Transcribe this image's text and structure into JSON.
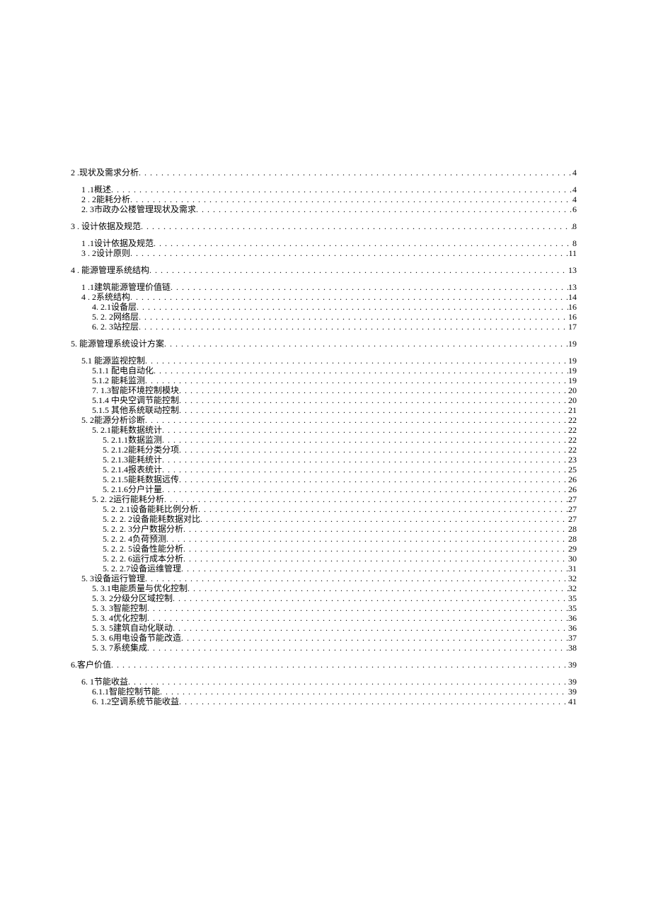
{
  "toc": [
    {
      "indent": 0,
      "label": "2     .现状及需求分析",
      "page": "4",
      "gap_after": 10
    },
    {
      "indent": 15,
      "label": "1     .1概述",
      "page": "4"
    },
    {
      "indent": 15,
      "label": "2     . 2能耗分析",
      "page": "4"
    },
    {
      "indent": 15,
      "label": "2. 3市政办公楼管理现状及需求",
      "page": "6",
      "gap_after": 10
    },
    {
      "indent": 0,
      "label": "3     . 设计依据及规范",
      "page": "8",
      "gap_after": 10
    },
    {
      "indent": 15,
      "label": "1     .1设计依据及规范",
      "page": "8"
    },
    {
      "indent": 15,
      "label": "3     . 2设计原则",
      "page": "11",
      "gap_after": 10
    },
    {
      "indent": 0,
      "label": "4     . 能源管理系统结构",
      "page": "13",
      "gap_after": 10
    },
    {
      "indent": 15,
      "label": "1     .1建筑能源管理价值链",
      "page": "13"
    },
    {
      "indent": 15,
      "label": "4     . 2系统结构",
      "page": "14"
    },
    {
      "indent": 30,
      "label": "4.    2.1设备层",
      "page": "16"
    },
    {
      "indent": 30,
      "label": "5.    2. 2网络层",
      "page": "16"
    },
    {
      "indent": 30,
      "label": "6.    2. 3站控层",
      "page": "17",
      "gap_after": 10
    },
    {
      "indent": 0,
      "label": "5. 能源管理系统设计方案",
      "page": "19",
      "gap_after": 10
    },
    {
      "indent": 15,
      "label": "5.1     能源监视控制",
      "page": "19"
    },
    {
      "indent": 30,
      "label": "5.1.1     配电自动化",
      "page": "19"
    },
    {
      "indent": 30,
      "label": "5.1.2     能耗监测",
      "page": "19"
    },
    {
      "indent": 30,
      "label": "7.    1.3智能环境控制模块",
      "page": "20"
    },
    {
      "indent": 30,
      "label": "5.1.4     中央空调节能控制",
      "page": "20"
    },
    {
      "indent": 30,
      "label": "5.1.5     其他系统联动控制",
      "page": "21"
    },
    {
      "indent": 15,
      "label": "5. 2能源分析诊断",
      "page": "22"
    },
    {
      "indent": 30,
      "label": "5. 2.1能耗数据统计",
      "page": "22"
    },
    {
      "indent": 45,
      "label": "5. 2.1.1数据监测",
      "page": "22"
    },
    {
      "indent": 45,
      "label": "5. 2.1.2能耗分类分项",
      "page": "22"
    },
    {
      "indent": 45,
      "label": "5. 2.1.3能耗统计",
      "page": "23"
    },
    {
      "indent": 45,
      "label": "5. 2.1.4报表统计",
      "page": "25"
    },
    {
      "indent": 45,
      "label": "5. 2.1.5能耗数据远传",
      "page": "26"
    },
    {
      "indent": 45,
      "label": "5. 2.1.6分户计量",
      "page": "26"
    },
    {
      "indent": 30,
      "label": "5. 2. 2运行能耗分析",
      "page": "27"
    },
    {
      "indent": 45,
      "label": "5. 2. 2.1设备能耗比例分析",
      "page": "27"
    },
    {
      "indent": 45,
      "label": "5. 2. 2. 2设备能耗数据对比",
      "page": "27"
    },
    {
      "indent": 45,
      "label": "5. 2. 2. 3分户数据分析",
      "page": "28"
    },
    {
      "indent": 45,
      "label": "5. 2. 2. 4负荷预测",
      "page": "28"
    },
    {
      "indent": 45,
      "label": "5. 2. 2. 5设备性能分析",
      "page": "29"
    },
    {
      "indent": 45,
      "label": "5. 2. 2. 6运行成本分析",
      "page": "30"
    },
    {
      "indent": 45,
      "label": "5. 2. 2.7设备运维管理",
      "page": "31"
    },
    {
      "indent": 15,
      "label": "5. 3设备运行管理",
      "page": "32"
    },
    {
      "indent": 30,
      "label": "5. 3.1电能质量与优化控制",
      "page": "32"
    },
    {
      "indent": 30,
      "label": "5. 3. 2分级分区域控制",
      "page": "35"
    },
    {
      "indent": 30,
      "label": "5. 3. 3智能控制",
      "page": "35"
    },
    {
      "indent": 30,
      "label": "5. 3. 4优化控制",
      "page": "36"
    },
    {
      "indent": 30,
      "label": "5. 3. 5建筑自动化联动",
      "page": "36"
    },
    {
      "indent": 30,
      "label": "5. 3. 6用电设备节能改造",
      "page": "37"
    },
    {
      "indent": 30,
      "label": "5. 3. 7系统集成",
      "page": "38",
      "gap_after": 10
    },
    {
      "indent": 0,
      "label": "6.客户价值",
      "page": "39",
      "gap_after": 10
    },
    {
      "indent": 15,
      "label": "6. 1节能收益",
      "page": "39"
    },
    {
      "indent": 30,
      "label": "6.1.1智能控制节能",
      "page": "39"
    },
    {
      "indent": 30,
      "label": "6. 1.2空调系统节能收益",
      "page": "41"
    }
  ]
}
